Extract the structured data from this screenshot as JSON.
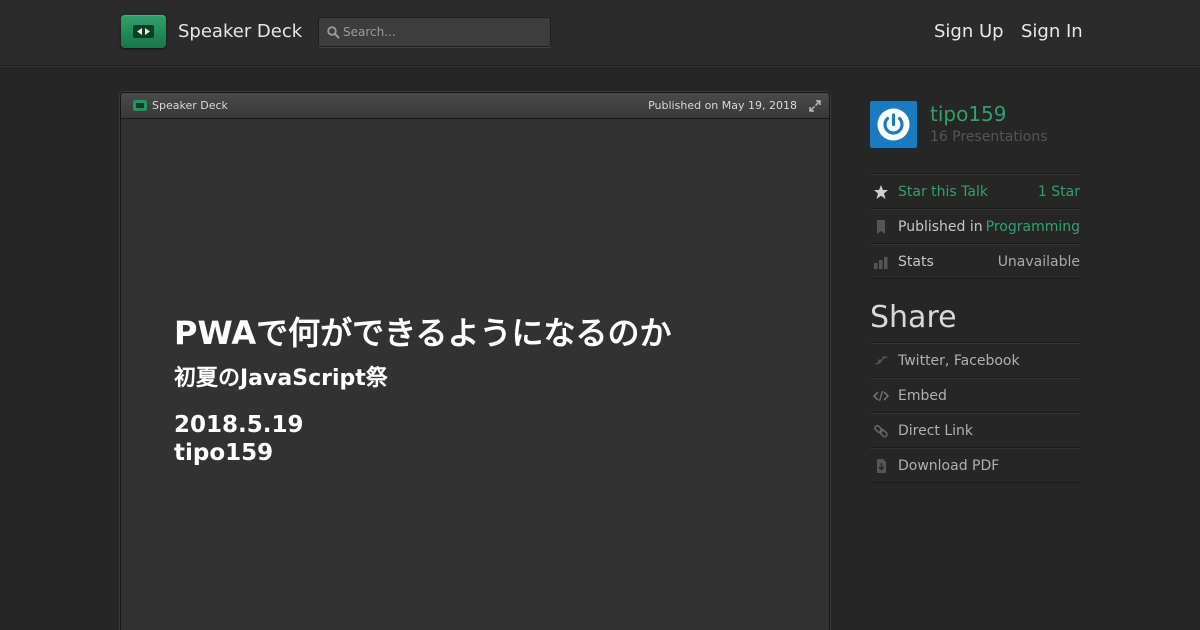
{
  "header": {
    "brand": "Speaker Deck",
    "search_placeholder": "Search...",
    "sign_up": "Sign Up",
    "sign_in": "Sign In"
  },
  "player": {
    "brand": "Speaker Deck",
    "published": "Published on May 19, 2018"
  },
  "slide": {
    "title": "PWAで何ができるようになるのか",
    "subtitle": "初夏のJavaScript祭",
    "date": "2018.5.19",
    "author": "tipo159"
  },
  "sidebar": {
    "author_name": "tipo159",
    "author_count": "16 Presentations",
    "items": [
      {
        "label": "Star this Talk",
        "value": "1 Star",
        "icon": "star-icon"
      },
      {
        "label": "Published in",
        "value": "Programming",
        "icon": "bookmark-icon"
      },
      {
        "label": "Stats",
        "value": "Unavailable",
        "icon": "bar-chart-icon"
      }
    ],
    "share_heading": "Share",
    "share_items": [
      {
        "label": "Twitter, Facebook",
        "icon": "bird-icon"
      },
      {
        "label": "Embed",
        "icon": "code-icon"
      },
      {
        "label": "Direct Link",
        "icon": "link-icon"
      },
      {
        "label": "Download PDF",
        "icon": "download-icon"
      }
    ]
  },
  "colors": {
    "accent": "#2fa26a",
    "background": "#262626",
    "avatar": "#1a7bc0"
  }
}
